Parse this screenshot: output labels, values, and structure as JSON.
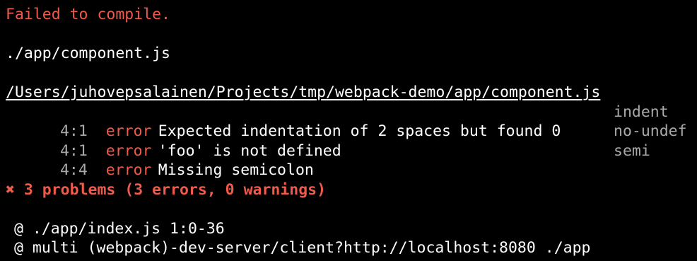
{
  "terminal": {
    "title": "Failed to compile.",
    "module_path": "./app/component.js",
    "file_path": "/Users/juhovepsalainen/Projects/tmp/webpack-demo/app/component.js",
    "problems": [
      {
        "location": "4:1",
        "severity": "error",
        "message": "Expected indentation of 2 spaces but found 0",
        "rule": "indent"
      },
      {
        "location": "4:1",
        "severity": "error",
        "message": "'foo' is not defined",
        "rule": "no-undef"
      },
      {
        "location": "4:4",
        "severity": "error",
        "message": "Missing semicolon",
        "rule": "semi"
      }
    ],
    "summary_icon": "✖",
    "summary_text": "3 problems (3 errors, 0 warnings)",
    "origins": [
      "@ ./app/index.js 1:0-36",
      "@ multi (webpack)-dev-server/client?http://localhost:8080 ./app"
    ]
  },
  "colors": {
    "background": "#000000",
    "error": "#ef5a4a",
    "dim": "#a8a8a8",
    "text": "#ffffff"
  }
}
